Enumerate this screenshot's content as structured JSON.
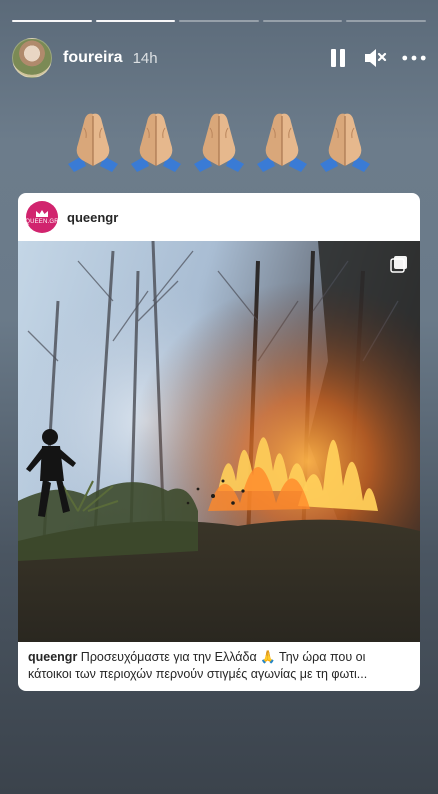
{
  "story": {
    "progress": {
      "total": 5,
      "completed": 2
    },
    "user": {
      "username": "foureira",
      "time_ago": "14h"
    },
    "controls": [
      {
        "name": "pause-icon"
      },
      {
        "name": "mute-icon"
      },
      {
        "name": "more-options-icon"
      }
    ],
    "emoji": {
      "name": "folded-hands-emoji",
      "count": 5
    }
  },
  "shared_post": {
    "username": "queengr",
    "avatar_text": "QUEEN.GR",
    "avatar_color": "#d1246e",
    "caption_user": "queengr",
    "caption_text": "Προσευχόμαστε για την Ελλάδα 🙏 Την ώρα που οι κάτοικοι των περιοχών περνούν στιγμές αγωνίας με τη φωτι..."
  },
  "colors": {
    "background_top": "#5b6a79",
    "background_bottom": "#3b434c",
    "card": "#ffffff"
  }
}
